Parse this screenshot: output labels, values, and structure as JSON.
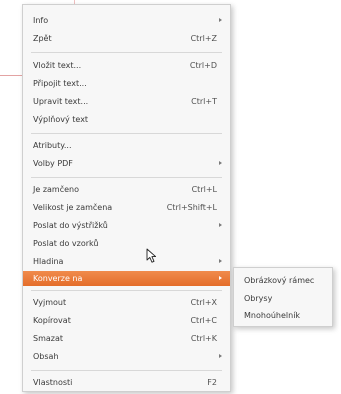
{
  "context_menu": {
    "items": [
      {
        "label": "Info",
        "shortcut": "",
        "submenu": true
      },
      {
        "label": "Zpět",
        "shortcut": "Ctrl+Z",
        "submenu": false
      },
      {
        "label": "Vložit text...",
        "shortcut": "Ctrl+D",
        "submenu": false
      },
      {
        "label": "Připojit text...",
        "shortcut": "",
        "submenu": false
      },
      {
        "label": "Upravit text...",
        "shortcut": "Ctrl+T",
        "submenu": false
      },
      {
        "label": "Výplňový text",
        "shortcut": "",
        "submenu": false
      },
      {
        "label": "Atributy...",
        "shortcut": "",
        "submenu": false
      },
      {
        "label": "Volby PDF",
        "shortcut": "",
        "submenu": true
      },
      {
        "label": "Je zamčeno",
        "shortcut": "Ctrl+L",
        "submenu": false
      },
      {
        "label": "Velikost je zamčena",
        "shortcut": "Ctrl+Shift+L",
        "submenu": false
      },
      {
        "label": "Poslat do výstřižků",
        "shortcut": "",
        "submenu": true
      },
      {
        "label": "Poslat do vzorků",
        "shortcut": "",
        "submenu": false
      },
      {
        "label": "Hladina",
        "shortcut": "",
        "submenu": true
      },
      {
        "label": "Konverze na",
        "shortcut": "",
        "submenu": true
      },
      {
        "label": "Vyjmout",
        "shortcut": "Ctrl+X",
        "submenu": false
      },
      {
        "label": "Kopírovat",
        "shortcut": "Ctrl+C",
        "submenu": false
      },
      {
        "label": "Smazat",
        "shortcut": "Ctrl+K",
        "submenu": false
      },
      {
        "label": "Obsah",
        "shortcut": "",
        "submenu": true
      },
      {
        "label": "Vlastnosti",
        "shortcut": "F2",
        "submenu": false
      }
    ],
    "highlighted_item": "Konverze na",
    "highlight_color": "#ea7a3a"
  },
  "submenu": {
    "items": [
      {
        "label": "Obrázkový rámec"
      },
      {
        "label": "Obrysy"
      },
      {
        "label": "Mnohoúhelník"
      }
    ]
  },
  "cursor": {
    "icon": "pointer-arrow-icon"
  }
}
